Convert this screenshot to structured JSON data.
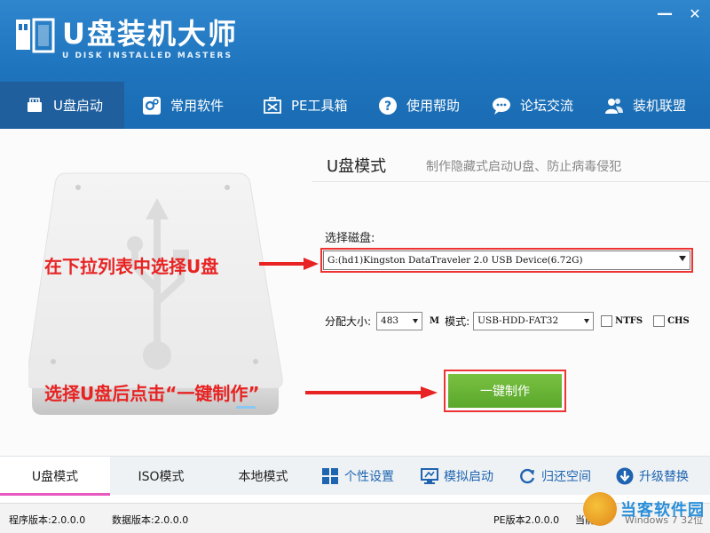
{
  "app": {
    "title": "U盘装机大师",
    "subtitle": "U DISK INSTALLED MASTERS"
  },
  "window_controls": {
    "minimize": "—",
    "close": "✕"
  },
  "nav": {
    "items": [
      {
        "label": "U盘启动",
        "icon": "usb-drive-icon",
        "active": true
      },
      {
        "label": "常用软件",
        "icon": "gear-icon",
        "active": false
      },
      {
        "label": "PE工具箱",
        "icon": "toolbox-icon",
        "active": false
      },
      {
        "label": "使用帮助",
        "icon": "help-icon",
        "active": false
      },
      {
        "label": "论坛交流",
        "icon": "chat-icon",
        "active": false
      },
      {
        "label": "装机联盟",
        "icon": "users-icon",
        "active": false
      }
    ]
  },
  "main": {
    "mode_title": "U盘模式",
    "mode_desc": "制作隐藏式启动U盘、防止病毒侵犯",
    "disk_label": "选择磁盘:",
    "disk_value": "G:(hd1)Kingston DataTraveler 2.0 USB Device(6.72G)",
    "alloc_label": "分配大小:",
    "alloc_value": "483",
    "alloc_unit": "M",
    "mode_label": "模式:",
    "mode_value": "USB-HDD-FAT32",
    "ntfs_label": "NTFS",
    "chs_label": "CHS",
    "primary_button": "一键制作"
  },
  "callouts": {
    "select_disk": "在下拉列表中选择U盘",
    "click_make": "选择U盘后点击“一键制作”"
  },
  "bottom": {
    "tabs": [
      {
        "label": "U盘模式",
        "active": true
      },
      {
        "label": "ISO模式",
        "active": false
      },
      {
        "label": "本地模式",
        "active": false
      }
    ],
    "actions": [
      {
        "label": "个性设置",
        "icon": "grid-icon"
      },
      {
        "label": "模拟启动",
        "icon": "monitor-icon"
      },
      {
        "label": "归还空间",
        "icon": "refresh-icon"
      },
      {
        "label": "升级替换",
        "icon": "download-icon"
      }
    ]
  },
  "status": {
    "program_version": "程序版本:2.0.0.0",
    "data_version": "数据版本:2.0.0.0",
    "pe_version": "PE版本2.0.0.0",
    "current_sys": "当前系",
    "windows_ver": "Windows 7 32位"
  },
  "watermark": {
    "text": "当客软件园"
  },
  "colors": {
    "header_blue": "#1e74bd",
    "nav_active": "#1f5f9e",
    "primary_green": "#5aa82c",
    "callout_red": "#e82323",
    "tab_accent": "#e85ac0",
    "action_blue": "#1f64b0"
  }
}
